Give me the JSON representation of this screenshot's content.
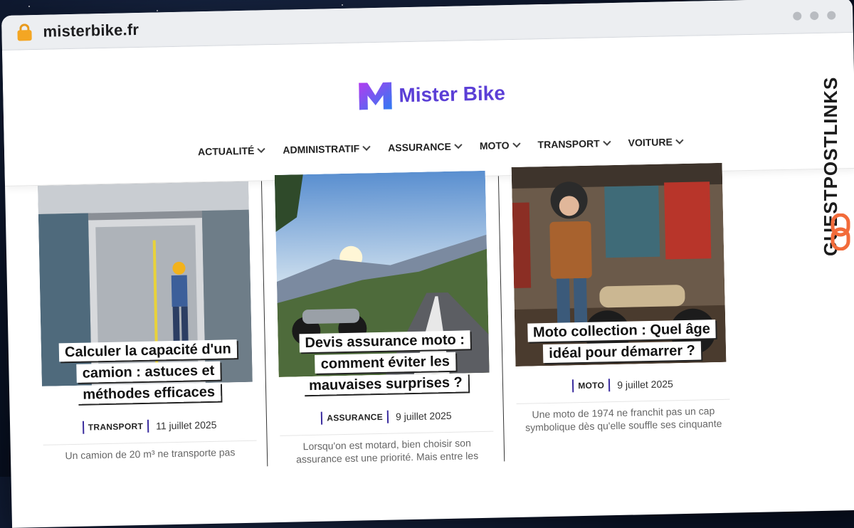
{
  "browser": {
    "url": "misterbike.fr"
  },
  "site": {
    "logo_text": "Mister Bike",
    "brand_color": "#5b3fd6",
    "nav": [
      {
        "label": "ACTUALITÉ"
      },
      {
        "label": "ADMINISTRATIF"
      },
      {
        "label": "ASSURANCE"
      },
      {
        "label": "MOTO"
      },
      {
        "label": "TRANSPORT"
      },
      {
        "label": "VOITURE"
      }
    ]
  },
  "articles": [
    {
      "title": "Calculer la capacité d'un camion : astuces et méthodes efficaces",
      "category": "TRANSPORT",
      "date": "11 juillet 2025",
      "excerpt": "Un camion de 20 m³ ne transporte pas"
    },
    {
      "title": "Devis assurance moto : comment éviter les mauvaises surprises ?",
      "category": "ASSURANCE",
      "date": "9 juillet 2025",
      "excerpt": "Lorsqu'on est motard, bien choisir son assurance est une priorité. Mais entre les"
    },
    {
      "title": "Moto collection : Quel âge idéal pour démarrer ?",
      "category": "MOTO",
      "date": "9 juillet 2025",
      "excerpt": "Une moto de 1974 ne franchit pas un cap symbolique dès qu'elle souffle ses cinquante"
    }
  ],
  "badge": {
    "text": "GUESTPOSTLINKS"
  }
}
